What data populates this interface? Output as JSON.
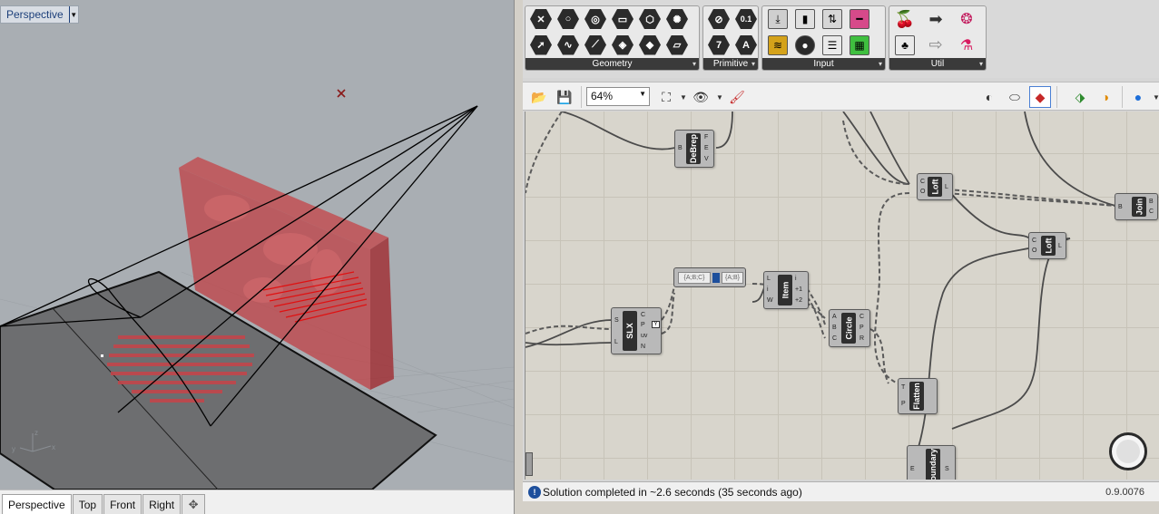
{
  "viewport": {
    "title": "Perspective",
    "tabs": [
      {
        "label": "Perspective",
        "active": true
      },
      {
        "label": "Top",
        "active": false
      },
      {
        "label": "Front",
        "active": false
      },
      {
        "label": "Right",
        "active": false
      }
    ],
    "add_tab_icon": "plus-icon"
  },
  "ribbon": {
    "groups": [
      {
        "label": "Geometry"
      },
      {
        "label": "Primitive"
      },
      {
        "label": "Input"
      },
      {
        "label": "Util"
      }
    ],
    "primitive_labels": [
      "0.1",
      "7",
      "A"
    ]
  },
  "toolbar": {
    "zoom": "64%"
  },
  "nodes": [
    {
      "id": "debrep",
      "title": "DeBrep",
      "inputs": [
        "B"
      ],
      "outputs": [
        "F",
        "E",
        "V"
      ]
    },
    {
      "id": "loft1",
      "title": "Loft",
      "inputs": [
        "C",
        "O"
      ],
      "outputs": [
        "L"
      ]
    },
    {
      "id": "join",
      "title": "Join",
      "inputs": [
        "B"
      ],
      "outputs": [
        "B",
        "C"
      ]
    },
    {
      "id": "loft2",
      "title": "Loft",
      "inputs": [
        "C",
        "O"
      ],
      "outputs": [
        "L"
      ]
    },
    {
      "id": "item",
      "title": "Item",
      "inputs": [
        "L",
        "i",
        "W"
      ],
      "outputs": [
        "i",
        "+1",
        "+2"
      ]
    },
    {
      "id": "slx",
      "title": "SLX",
      "inputs": [
        "S",
        "L"
      ],
      "outputs": [
        "C",
        "P",
        "uv",
        "N"
      ]
    },
    {
      "id": "circle",
      "title": "Circle",
      "inputs": [
        "A",
        "B",
        "C"
      ],
      "outputs": [
        "C",
        "P",
        "R"
      ]
    },
    {
      "id": "flatten",
      "title": "Flatten",
      "inputs": [
        "T",
        "P"
      ],
      "outputs": []
    },
    {
      "id": "boundary",
      "title": "Boundary",
      "inputs": [
        "E"
      ],
      "outputs": [
        "S"
      ]
    }
  ],
  "panel": {
    "left_text": "{A;B;C}",
    "right_text": "{A;B}"
  },
  "status": {
    "message": "Solution completed in ~2.6 seconds (35 seconds ago)",
    "version": "0.9.0076"
  },
  "axis_labels": {
    "x": "x",
    "y": "y",
    "z": "z"
  }
}
